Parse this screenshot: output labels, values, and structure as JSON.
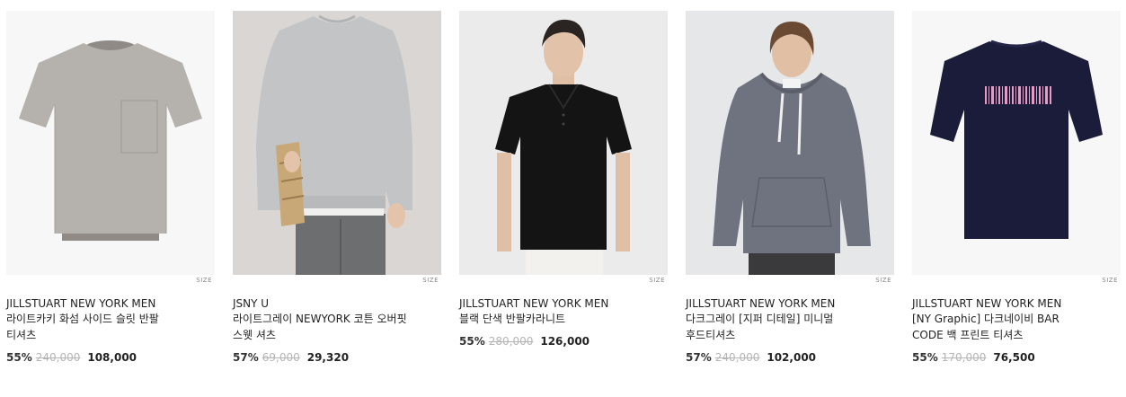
{
  "size_label": "SIZE",
  "products": [
    {
      "brand": "JILLSTUART NEW YORK MEN",
      "name": "라이트카키 화섬 사이드 슬릿 반팔 티셔츠",
      "discount": "55%",
      "original_price": "240,000",
      "sale_price": "108,000",
      "image_icon": "gray-tshirt-image"
    },
    {
      "brand": "JSNY U",
      "name": "라이트그레이 NEWYORK 코튼 오버핏 스웻 셔츠",
      "discount": "57%",
      "original_price": "69,000",
      "sale_price": "29,320",
      "image_icon": "gray-sweatshirt-image"
    },
    {
      "brand": "JILLSTUART NEW YORK MEN",
      "name": "블랙 단색 반팔카라니트",
      "discount": "55%",
      "original_price": "280,000",
      "sale_price": "126,000",
      "image_icon": "black-polo-image"
    },
    {
      "brand": "JILLSTUART NEW YORK MEN",
      "name": "다크그레이 [지퍼 디테일] 미니멀 후드티셔츠",
      "discount": "57%",
      "original_price": "240,000",
      "sale_price": "102,000",
      "image_icon": "gray-hoodie-image"
    },
    {
      "brand": "JILLSTUART NEW YORK MEN",
      "name": "[NY Graphic] 다크네이비 BAR CODE 백 프린트 티셔츠",
      "discount": "55%",
      "original_price": "170,000",
      "sale_price": "76,500",
      "image_icon": "navy-barcode-tshirt-image"
    }
  ]
}
